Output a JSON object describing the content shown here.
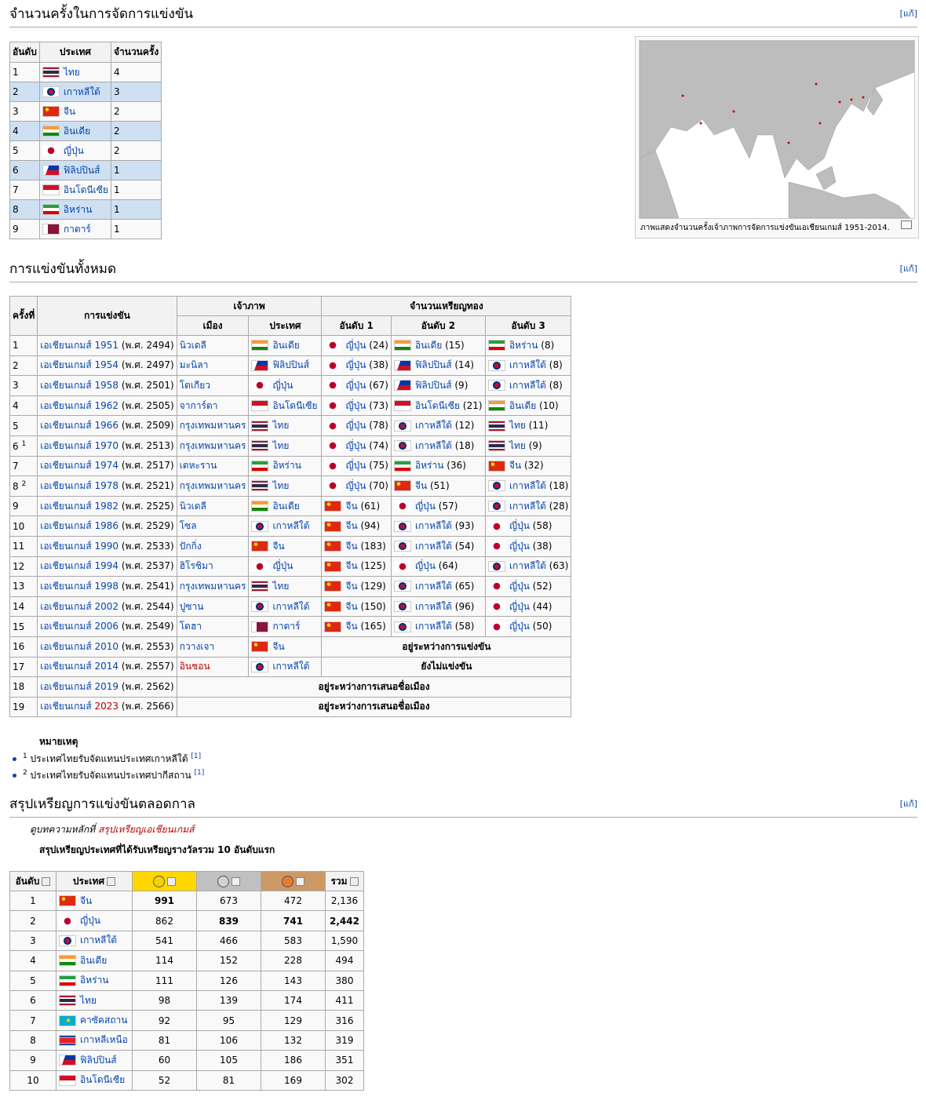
{
  "edit_label": "[แก้]",
  "sections": {
    "hosting_count": "จำนวนครั้งในการจัดการแข่งขัน",
    "all_games": "การแข่งขันทั้งหมด",
    "medal_summary": "สรุปเหรียญการแข่งขันตลอดกาล"
  },
  "host_count_table": {
    "headers": [
      "อันดับ",
      "ประเทศ",
      "จำนวนครั้ง"
    ],
    "rows": [
      {
        "rank": "1",
        "flag": "TH",
        "country": "ไทย",
        "count": "4"
      },
      {
        "rank": "2",
        "flag": "KR",
        "country": "เกาหลีใต้",
        "count": "3"
      },
      {
        "rank": "3",
        "flag": "CN",
        "country": "จีน",
        "count": "2"
      },
      {
        "rank": "4",
        "flag": "IN",
        "country": "อินเดีย",
        "count": "2"
      },
      {
        "rank": "5",
        "flag": "JP",
        "country": "ญี่ปุ่น",
        "count": "2"
      },
      {
        "rank": "6",
        "flag": "PH",
        "country": "ฟิลิปปินส์",
        "count": "1"
      },
      {
        "rank": "7",
        "flag": "ID",
        "country": "อินโดนีเซีย",
        "count": "1"
      },
      {
        "rank": "8",
        "flag": "IR",
        "country": "อิหร่าน",
        "count": "1"
      },
      {
        "rank": "9",
        "flag": "QA",
        "country": "กาตาร์",
        "count": "1"
      }
    ]
  },
  "map": {
    "caption": "ภาพแสดงจำนวนครั้งเจ้าภาพการจัดการแข่งขันเอเชียนเกมส์ 1951-2014."
  },
  "games_table": {
    "headers": {
      "edition": "ครั้งที่",
      "games": "การแข่งขัน",
      "host": "เจ้าภาพ",
      "medals": "จำนวนเหรียญทอง",
      "city": "เมือง",
      "country": "ประเทศ",
      "first": "อันดับ 1",
      "second": "อันดับ 2",
      "third": "อันดับ 3"
    },
    "rows": [
      {
        "no": "1",
        "sup": "",
        "game": "เอเชียนเกมส์ 1951",
        "year": " (พ.ศ. 2494)",
        "city": "นิวเดลี",
        "hflag": "IN",
        "hcountry": "อินเดีย",
        "m1f": "JP",
        "m1": "ญี่ปุ่น",
        "m1n": " (24)",
        "m2f": "IN",
        "m2": "อินเดีย",
        "m2n": " (15)",
        "m3f": "IR",
        "m3": "อิหร่าน",
        "m3n": " (8)"
      },
      {
        "no": "2",
        "sup": "",
        "game": "เอเชียนเกมส์ 1954",
        "year": " (พ.ศ. 2497)",
        "city": "มะนิลา",
        "hflag": "PH",
        "hcountry": "ฟิลิปปินส์",
        "m1f": "JP",
        "m1": "ญี่ปุ่น",
        "m1n": " (38)",
        "m2f": "PH",
        "m2": "ฟิลิปปินส์",
        "m2n": " (14)",
        "m3f": "KR",
        "m3": "เกาหลีใต้",
        "m3n": " (8)"
      },
      {
        "no": "3",
        "sup": "",
        "game": "เอเชียนเกมส์ 1958",
        "year": " (พ.ศ. 2501)",
        "city": "โตเกียว",
        "hflag": "JP",
        "hcountry": "ญี่ปุ่น",
        "m1f": "JP",
        "m1": "ญี่ปุ่น",
        "m1n": " (67)",
        "m2f": "PH",
        "m2": "ฟิลิปปินส์",
        "m2n": " (9)",
        "m3f": "KR",
        "m3": "เกาหลีใต้",
        "m3n": " (8)"
      },
      {
        "no": "4",
        "sup": "",
        "game": "เอเชียนเกมส์ 1962",
        "year": " (พ.ศ. 2505)",
        "city": "จาการ์ตา",
        "hflag": "ID",
        "hcountry": "อินโดนีเซีย",
        "m1f": "JP",
        "m1": "ญี่ปุ่น",
        "m1n": " (73)",
        "m2f": "ID",
        "m2": "อินโดนีเซีย",
        "m2n": " (21)",
        "m3f": "IN",
        "m3": "อินเดีย",
        "m3n": " (10)"
      },
      {
        "no": "5",
        "sup": "",
        "game": "เอเชียนเกมส์ 1966",
        "year": " (พ.ศ. 2509)",
        "city": "กรุงเทพมหานคร",
        "hflag": "TH",
        "hcountry": "ไทย",
        "m1f": "JP",
        "m1": "ญี่ปุ่น",
        "m1n": " (78)",
        "m2f": "KR",
        "m2": "เกาหลีใต้",
        "m2n": " (12)",
        "m3f": "TH",
        "m3": "ไทย",
        "m3n": " (11)"
      },
      {
        "no": "6",
        "sup": "1",
        "game": "เอเชียนเกมส์ 1970",
        "year": " (พ.ศ. 2513)",
        "city": "กรุงเทพมหานคร",
        "hflag": "TH",
        "hcountry": "ไทย",
        "m1f": "JP",
        "m1": "ญี่ปุ่น",
        "m1n": " (74)",
        "m2f": "KR",
        "m2": "เกาหลีใต้",
        "m2n": " (18)",
        "m3f": "TH",
        "m3": "ไทย",
        "m3n": " (9)"
      },
      {
        "no": "7",
        "sup": "",
        "game": "เอเชียนเกมส์ 1974",
        "year": " (พ.ศ. 2517)",
        "city": "เตหะราน",
        "hflag": "IR",
        "hcountry": "อิหร่าน",
        "m1f": "JP",
        "m1": "ญี่ปุ่น",
        "m1n": " (75)",
        "m2f": "IR",
        "m2": "อิหร่าน",
        "m2n": " (36)",
        "m3f": "CN",
        "m3": "จีน",
        "m3n": " (32)"
      },
      {
        "no": "8",
        "sup": "2",
        "game": "เอเชียนเกมส์ 1978",
        "year": " (พ.ศ. 2521)",
        "city": "กรุงเทพมหานคร",
        "hflag": "TH",
        "hcountry": "ไทย",
        "m1f": "JP",
        "m1": "ญี่ปุ่น",
        "m1n": " (70)",
        "m2f": "CN",
        "m2": "จีน",
        "m2n": " (51)",
        "m3f": "KR",
        "m3": "เกาหลีใต้",
        "m3n": " (18)"
      },
      {
        "no": "9",
        "sup": "",
        "game": "เอเชียนเกมส์ 1982",
        "year": " (พ.ศ. 2525)",
        "city": "นิวเดลี",
        "hflag": "IN",
        "hcountry": "อินเดีย",
        "m1f": "CN",
        "m1": "จีน",
        "m1n": " (61)",
        "m2f": "JP",
        "m2": "ญี่ปุ่น",
        "m2n": " (57)",
        "m3f": "KR",
        "m3": "เกาหลีใต้",
        "m3n": " (28)"
      },
      {
        "no": "10",
        "sup": "",
        "game": "เอเชียนเกมส์ 1986",
        "year": " (พ.ศ. 2529)",
        "city": "โซล",
        "hflag": "KR",
        "hcountry": "เกาหลีใต้",
        "m1f": "CN",
        "m1": "จีน",
        "m1n": " (94)",
        "m2f": "KR",
        "m2": "เกาหลีใต้",
        "m2n": " (93)",
        "m3f": "JP",
        "m3": "ญี่ปุ่น",
        "m3n": " (58)"
      },
      {
        "no": "11",
        "sup": "",
        "game": "เอเชียนเกมส์ 1990",
        "year": " (พ.ศ. 2533)",
        "city": "ปักกิ่ง",
        "hflag": "CN",
        "hcountry": "จีน",
        "m1f": "CN",
        "m1": "จีน",
        "m1n": " (183)",
        "m2f": "KR",
        "m2": "เกาหลีใต้",
        "m2n": " (54)",
        "m3f": "JP",
        "m3": "ญี่ปุ่น",
        "m3n": " (38)"
      },
      {
        "no": "12",
        "sup": "",
        "game": "เอเชียนเกมส์ 1994",
        "year": " (พ.ศ. 2537)",
        "city": "ฮิโรชิมา",
        "hflag": "JP",
        "hcountry": "ญี่ปุ่น",
        "m1f": "CN",
        "m1": "จีน",
        "m1n": " (125)",
        "m2f": "JP",
        "m2": "ญี่ปุ่น",
        "m2n": " (64)",
        "m3f": "KR",
        "m3": "เกาหลีใต้",
        "m3n": " (63)"
      },
      {
        "no": "13",
        "sup": "",
        "game": "เอเชียนเกมส์ 1998",
        "year": " (พ.ศ. 2541)",
        "city": "กรุงเทพมหานคร",
        "hflag": "TH",
        "hcountry": "ไทย",
        "m1f": "CN",
        "m1": "จีน",
        "m1n": " (129)",
        "m2f": "KR",
        "m2": "เกาหลีใต้",
        "m2n": " (65)",
        "m3f": "JP",
        "m3": "ญี่ปุ่น",
        "m3n": " (52)"
      },
      {
        "no": "14",
        "sup": "",
        "game": "เอเชียนเกมส์ 2002",
        "year": " (พ.ศ. 2544)",
        "city": "ปูซาน",
        "hflag": "KR",
        "hcountry": "เกาหลีใต้",
        "m1f": "CN",
        "m1": "จีน",
        "m1n": " (150)",
        "m2f": "KR",
        "m2": "เกาหลีใต้",
        "m2n": " (96)",
        "m3f": "JP",
        "m3": "ญี่ปุ่น",
        "m3n": " (44)"
      },
      {
        "no": "15",
        "sup": "",
        "game": "เอเชียนเกมส์ 2006",
        "year": " (พ.ศ. 2549)",
        "city": "โดฮา",
        "hflag": "QA",
        "hcountry": "กาตาร์",
        "m1f": "CN",
        "m1": "จีน",
        "m1n": " (165)",
        "m2f": "KR",
        "m2": "เกาหลีใต้",
        "m2n": " (58)",
        "m3f": "JP",
        "m3": "ญี่ปุ่น",
        "m3n": " (50)"
      }
    ],
    "rows_special": [
      {
        "no": "16",
        "game": "เอเชียนเกมส์ 2010",
        "year": " (พ.ศ. 2553)",
        "city": "กวางเจา",
        "hflag": "CN",
        "hcountry": "จีน",
        "status": "อยู่ระหว่างการแข่งขัน"
      },
      {
        "no": "17",
        "game": "เอเชียนเกมส์ 2014",
        "year": " (พ.ศ. 2557)",
        "city": "อินชอน",
        "hflag": "KR",
        "hcountry": "เกาหลีใต้",
        "status": "ยังไม่แข่งขัน"
      }
    ],
    "rows_bid": [
      {
        "no": "18",
        "game": "เอเชียนเกมส์ 2019",
        "year": " (พ.ศ. 2562)",
        "status": "อยู่ระหว่างการเสนอชื่อเมือง"
      },
      {
        "no": "19",
        "game_prefix": "เอเชียนเกมส์ ",
        "game_year": "2023",
        "year": " (พ.ศ. 2566)",
        "status": "อยู่ระหว่างการเสนอชื่อเมือง"
      }
    ]
  },
  "notes": {
    "title": "หมายเหตุ",
    "items": [
      {
        "sup": "1",
        "text": " ประเทศไทยรับจัดแทนประเทศเกาหลีใต้ ",
        "ref": "[1]"
      },
      {
        "sup": "2",
        "text": " ประเทศไทยรับจัดแทนประเทศปากีสถาน ",
        "ref": "[1]"
      }
    ]
  },
  "medal_section": {
    "hatnote_prefix": "ดูบทความหลักที่ ",
    "hatnote_link": "สรุปเหรียญเอเชียนเกมส์",
    "subtitle": "สรุปเหรียญประเทศที่ได้รับเหรียญรางวัลรวม 10 อันดับแรก",
    "headers": {
      "rank": "อันดับ",
      "country": "ประเทศ",
      "total": "รวม"
    },
    "rows": [
      {
        "rank": "1",
        "flag": "CN",
        "country": "จีน",
        "gold": "991",
        "silver": "673",
        "bronze": "472",
        "total": "2,136"
      },
      {
        "rank": "2",
        "flag": "JP",
        "country": "ญี่ปุ่น",
        "gold": "862",
        "silver": "839",
        "bronze": "741",
        "total": "2,442"
      },
      {
        "rank": "3",
        "flag": "KR",
        "country": "เกาหลีใต้",
        "gold": "541",
        "silver": "466",
        "bronze": "583",
        "total": "1,590"
      },
      {
        "rank": "4",
        "flag": "IN",
        "country": "อินเดีย",
        "gold": "114",
        "silver": "152",
        "bronze": "228",
        "total": "494"
      },
      {
        "rank": "5",
        "flag": "IR",
        "country": "อิหร่าน",
        "gold": "111",
        "silver": "126",
        "bronze": "143",
        "total": "380"
      },
      {
        "rank": "6",
        "flag": "TH",
        "country": "ไทย",
        "gold": "98",
        "silver": "139",
        "bronze": "174",
        "total": "411"
      },
      {
        "rank": "7",
        "flag": "KZ",
        "country": "คาซัคสถาน",
        "gold": "92",
        "silver": "95",
        "bronze": "129",
        "total": "316"
      },
      {
        "rank": "8",
        "flag": "KP",
        "country": "เกาหลีเหนือ",
        "gold": "81",
        "silver": "106",
        "bronze": "132",
        "total": "319"
      },
      {
        "rank": "9",
        "flag": "PH",
        "country": "ฟิลิปปินส์",
        "gold": "60",
        "silver": "105",
        "bronze": "186",
        "total": "351"
      },
      {
        "rank": "10",
        "flag": "ID",
        "country": "อินโดนีเซีย",
        "gold": "52",
        "silver": "81",
        "bronze": "169",
        "total": "302"
      }
    ]
  }
}
